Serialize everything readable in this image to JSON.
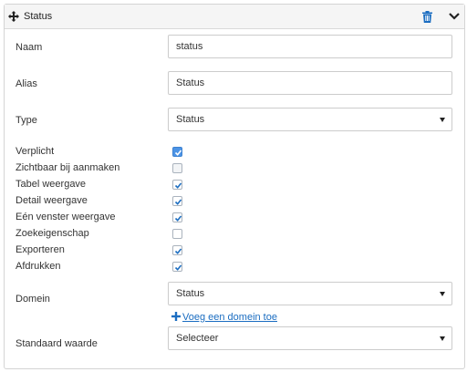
{
  "header": {
    "title": "Status"
  },
  "fields": {
    "naam": {
      "label": "Naam",
      "value": "status"
    },
    "alias": {
      "label": "Alias",
      "value": "Status"
    },
    "type": {
      "label": "Type",
      "value": "Status"
    }
  },
  "checkboxes": [
    {
      "label": "Verplicht",
      "checked": true
    },
    {
      "label": "Zichtbaar bij aanmaken",
      "checked": false
    },
    {
      "label": "Tabel weergave",
      "checked": true
    },
    {
      "label": "Detail weergave",
      "checked": true
    },
    {
      "label": "Eén venster weergave",
      "checked": true
    },
    {
      "label": "Zoekeigenschap",
      "checked": false
    },
    {
      "label": "Exporteren",
      "checked": true
    },
    {
      "label": "Afdrukken",
      "checked": true
    }
  ],
  "domein": {
    "label": "Domein",
    "value": "Status",
    "add_link": "Voeg een domein toe"
  },
  "standaard": {
    "label": "Standaard waarde",
    "value": "Selecteer"
  },
  "colors": {
    "accent": "#1b6dc1",
    "check": "#1b6dc1",
    "highlight": "#4c94e6"
  },
  "icons": {
    "move": "move-icon",
    "trash": "trash-icon",
    "collapse": "chevron-down-icon",
    "add": "plus-icon"
  }
}
